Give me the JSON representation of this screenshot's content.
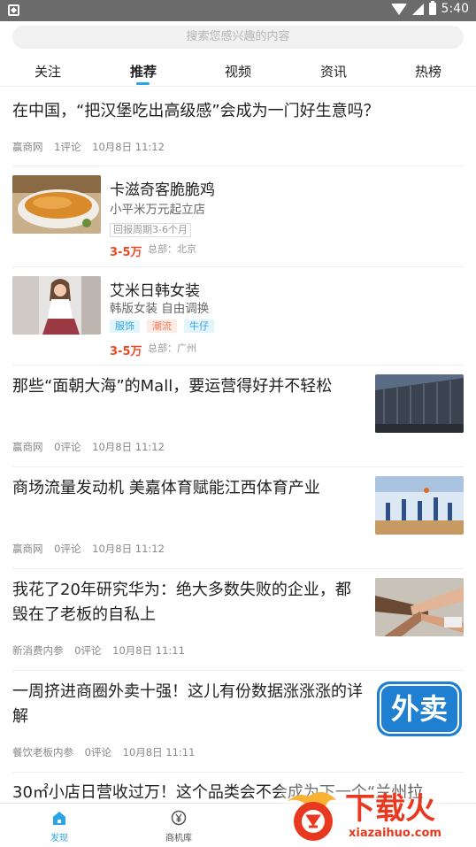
{
  "status": {
    "time": "5:40"
  },
  "search": {
    "placeholder": "搜索您感兴趣的内容"
  },
  "tabs": [
    "关注",
    "推荐",
    "视频",
    "资讯",
    "热榜"
  ],
  "active_tab": "推荐",
  "articles": [
    {
      "title": "在中国，“把汉堡吃出高级感”会成为一门好生意吗？",
      "source": "赢商网",
      "comments": "1评论",
      "time": "10月8日 11:12"
    },
    {
      "title": "那些“面朝大海”的Mall，要运营得好并不轻松",
      "source": "赢商网",
      "comments": "0评论",
      "time": "10月8日 11:12",
      "thumb": "mall-building-image"
    },
    {
      "title": "商场流量发动机 美嘉体育赋能江西体育产业",
      "source": "赢商网",
      "comments": "0评论",
      "time": "10月8日 11:12",
      "thumb": "basketball-court-image"
    },
    {
      "title": "我花了20年研究华为：绝大多数失败的企业，都毁在了老板的自私上",
      "source": "新消费内参",
      "comments": "0评论",
      "time": "10月8日 11:11",
      "thumb": "stacked-hands-image"
    },
    {
      "title": "一周挤进商圈外卖十强！这儿有份数据涨涨涨的详解",
      "source": "餐饮老板内参",
      "comments": "0评论",
      "time": "10月8日 11:11",
      "thumb_text": "外卖"
    },
    {
      "title": "30㎡小店日营收过万！这个品类会不会成为下一个“兰州拉"
    }
  ],
  "brands": [
    {
      "name": "卡滋奇客脆脆鸡",
      "desc": "小平米万元起立店",
      "outline_tag": "回报周期3-6个月",
      "price": "3-5万",
      "hq": "总部：北京"
    },
    {
      "name": "艾米日韩女装",
      "desc": "韩版女装 自由调换",
      "tags": [
        "服饰",
        "潮流",
        "牛仔"
      ],
      "price": "3-5万",
      "hq": "总部：广州"
    }
  ],
  "bottom_nav": [
    {
      "label": "发现",
      "active": true
    },
    {
      "label": "商机库",
      "active": false
    }
  ],
  "watermark": {
    "text": "下载火",
    "url": "xiazaihuo.com"
  },
  "colors": {
    "accent": "#2aa4e6",
    "price": "#f04a24",
    "status_bar": "#6b6b6b"
  }
}
